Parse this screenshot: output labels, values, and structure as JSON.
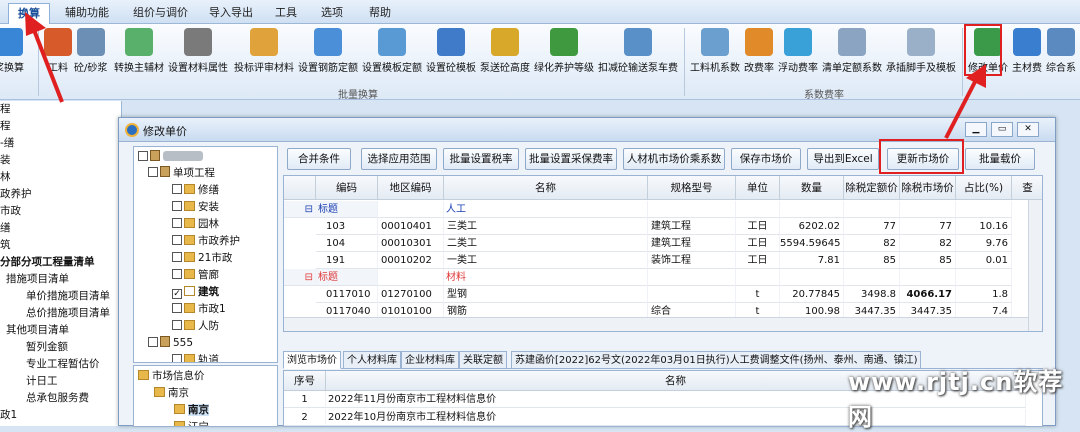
{
  "menu": [
    "换算",
    "辅助功能",
    "组价与调价",
    "导入导出",
    "工具",
    "选项",
    "帮助"
  ],
  "ribbon": {
    "items": [
      "浆换算",
      "工料",
      "砼/砂浆",
      "转换主辅材",
      "设置材料属性",
      "投标评审材料",
      "设置钢筋定额",
      "设置模板定额",
      "设置砼模板",
      "泵送砼高度",
      "绿化养护等级",
      "扣减砼输送泵车费",
      "工料机系数",
      "改费率",
      "浮动费率",
      "清单定额系数",
      "承插脚手及模板",
      "修改单价",
      "主材费",
      "综合系"
    ],
    "groups": [
      "批量换算",
      "系数费率"
    ]
  },
  "left_tree": [
    "程",
    "程",
    "-缮",
    "装",
    "林",
    "政养护",
    "市政",
    "缮",
    "筑",
    "分部分项工程量清单",
    "措施项目清单",
    "单价措施项目清单",
    "总价措施项目清单",
    "其他项目清单",
    "暂列金额",
    "专业工程暂估价",
    "计日工",
    "总承包服务费",
    "政1"
  ],
  "modal": {
    "title": "修改单价",
    "toolbar": [
      "合并条件",
      "选择应用范围",
      "批量设置税率",
      "批量设置采保费率",
      "人材机市场价乘系数",
      "保存市场价",
      "导出到Excel",
      "更新市场价",
      "批量载价"
    ],
    "tree": [
      "单项工程",
      "修缮",
      "安装",
      "园林",
      "市政养护",
      "21市政",
      "管廊",
      "建筑",
      "市政1",
      "人防",
      "555",
      "轨道"
    ],
    "tree2": [
      "市场信息价",
      "南京",
      "南京",
      "江宁"
    ],
    "grid": {
      "headers": [
        "编码",
        "地区编码",
        "名称",
        "规格型号",
        "单位",
        "数量",
        "除税定额价",
        "除税市场价",
        "占比(%)",
        "查"
      ],
      "rows": [
        {
          "type": "group",
          "c1": "标题",
          "name": "人工"
        },
        {
          "c0": "103",
          "c1": "00010401",
          "name": "三类工",
          "spec": "建筑工程",
          "unit": "工日",
          "qty": "6202.02",
          "p1": "77",
          "p2": "77",
          "pct": "10.16"
        },
        {
          "c0": "104",
          "c1": "00010301",
          "name": "二类工",
          "spec": "建筑工程",
          "unit": "工日",
          "qty": "5594.59645",
          "p1": "82",
          "p2": "82",
          "pct": "9.76"
        },
        {
          "c0": "191",
          "c1": "00010202",
          "name": "一类工",
          "spec": "装饰工程",
          "unit": "工日",
          "qty": "7.81",
          "p1": "85",
          "p2": "85",
          "pct": "0.01"
        },
        {
          "type": "group",
          "c1": "标题",
          "name": "材料"
        },
        {
          "c0": "0117010",
          "c1": "01270100",
          "name": "型钢",
          "spec": "",
          "unit": "t",
          "qty": "20.77845",
          "p1": "3498.8",
          "p2": "4066.17",
          "pct": "1.8"
        },
        {
          "c0": "0117040",
          "c1": "01010100",
          "name": "钢筋",
          "spec": "综合",
          "unit": "t",
          "qty": "100.98",
          "p1": "3447.35",
          "p2": "3447.35",
          "pct": "7.4"
        }
      ]
    },
    "tabs": [
      "浏览市场价",
      "个人材料库",
      "企业材料库",
      "关联定额",
      "苏建函价[2022]62号文(2022年03月01日执行)人工费调整文件(扬州、泰州、南通、镇江)"
    ],
    "lower": {
      "headers": [
        "序号",
        "名称"
      ],
      "rows": [
        {
          "no": "1",
          "name": "2022年11月份南京市工程材料信息价"
        },
        {
          "no": "2",
          "name": "2022年10月份南京市工程材料信息价"
        }
      ]
    }
  },
  "watermark": "www.rjtj.cn软荐网"
}
